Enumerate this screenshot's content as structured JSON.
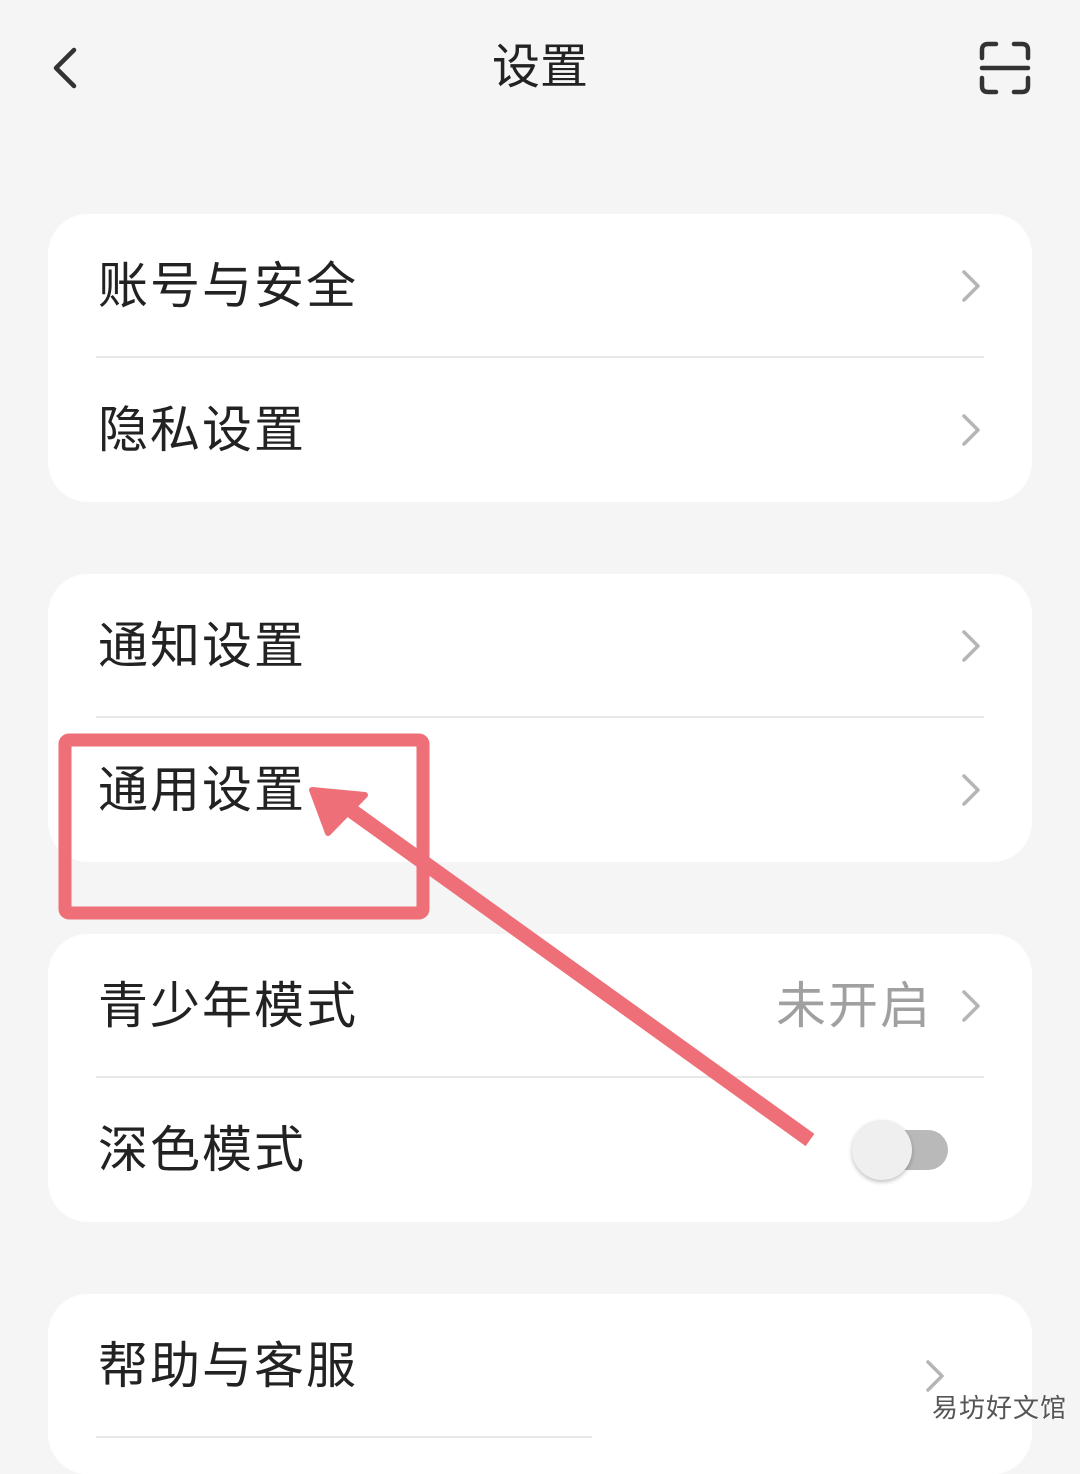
{
  "header": {
    "title": "设置",
    "back_icon": "chevron-left-icon",
    "scan_icon": "scan-icon"
  },
  "groups": [
    {
      "items": [
        {
          "label": "账号与安全",
          "icon": "chevron-right-icon"
        },
        {
          "label": "隐私设置",
          "icon": "chevron-right-icon"
        }
      ]
    },
    {
      "items": [
        {
          "label": "通知设置",
          "icon": "chevron-right-icon"
        },
        {
          "label": "通用设置",
          "icon": "chevron-right-icon"
        }
      ]
    },
    {
      "items": [
        {
          "label": "青少年模式",
          "value": "未开启",
          "icon": "chevron-right-icon"
        },
        {
          "label": "深色模式",
          "toggle": false
        }
      ]
    },
    {
      "items": [
        {
          "label": "帮助与客服",
          "icon": "chevron-right-icon"
        }
      ]
    }
  ],
  "annotation": {
    "highlight_color": "#ee6f77",
    "target": "通用设置"
  },
  "watermark": "易坊好文馆",
  "colors": {
    "background": "#f5f5f5",
    "card": "#ffffff",
    "text": "#222222",
    "secondary_text": "#a0a0a0",
    "annotation": "#ee6f77"
  }
}
